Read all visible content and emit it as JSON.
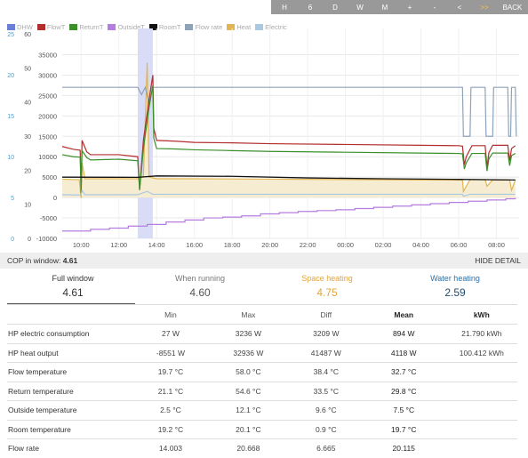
{
  "toolbar": {
    "buttons": [
      {
        "label": "H",
        "accent": false
      },
      {
        "label": "6",
        "accent": false
      },
      {
        "label": "D",
        "accent": false
      },
      {
        "label": "W",
        "accent": false
      },
      {
        "label": "M",
        "accent": false
      },
      {
        "label": "+",
        "accent": false
      },
      {
        "label": "-",
        "accent": false
      },
      {
        "label": "<",
        "accent": false
      },
      {
        "label": ">>",
        "accent": true
      },
      {
        "label": "BACK",
        "accent": false
      }
    ]
  },
  "legend": [
    {
      "label": "DHW",
      "color": "#6a7fd6"
    },
    {
      "label": "FlowT",
      "color": "#b22d2d"
    },
    {
      "label": "ReturnT",
      "color": "#3a8f2a"
    },
    {
      "label": "OutsideT",
      "color": "#b57de0"
    },
    {
      "label": "RoomT",
      "color": "#111111"
    },
    {
      "label": "Flow rate",
      "color": "#8ea3b8"
    },
    {
      "label": "Heat",
      "color": "#e3b552"
    },
    {
      "label": "Electric",
      "color": "#a9c9e3"
    }
  ],
  "chart_data": {
    "type": "line",
    "x_ticks": [
      "10:00",
      "12:00",
      "14:00",
      "16:00",
      "18:00",
      "20:00",
      "22:00",
      "00:00",
      "02:00",
      "04:00",
      "06:00",
      "08:00"
    ],
    "y_axis_left1": {
      "ticks": [
        25,
        20,
        15,
        10,
        5,
        0
      ],
      "color": "#4a9fd6"
    },
    "y_axis_left2": {
      "ticks": [
        60,
        50,
        40,
        30,
        20,
        10,
        0
      ],
      "color": "#555555"
    },
    "y_axis_main": {
      "ticks": [
        35000,
        30000,
        25000,
        20000,
        15000,
        10000,
        5000,
        0,
        -5000,
        -10000
      ],
      "ylim": [
        -10000,
        35000
      ]
    },
    "highlight": {
      "from_hour": 13.0,
      "to_hour": 13.8,
      "color": "#d8dcf6"
    },
    "series": [
      {
        "name": "Heat",
        "kind": "area",
        "color": "#e3b552",
        "fill": "#f5ecd2",
        "points": [
          [
            9,
            4500
          ],
          [
            9.7,
            4400
          ],
          [
            9.9,
            4400
          ],
          [
            10,
            -100
          ],
          [
            10.05,
            8500
          ],
          [
            10.2,
            4600
          ],
          [
            13.0,
            4600
          ],
          [
            13.3,
            5200
          ],
          [
            13.5,
            33000
          ],
          [
            13.6,
            5000
          ],
          [
            14.0,
            4600
          ],
          [
            16,
            4600
          ],
          [
            20,
            4500
          ],
          [
            24,
            4400
          ],
          [
            28,
            4300
          ],
          [
            30.2,
            4300
          ],
          [
            30.25,
            1500
          ],
          [
            30.6,
            4400
          ],
          [
            31.4,
            4400
          ],
          [
            31.5,
            2800
          ],
          [
            31.8,
            4300
          ],
          [
            32.7,
            4300
          ],
          [
            32.8,
            1800
          ],
          [
            33.0,
            4300
          ]
        ]
      },
      {
        "name": "Flow rate",
        "color": "#8ea3b8",
        "points": [
          [
            9,
            20.6
          ],
          [
            13.0,
            20.6
          ],
          [
            13.2,
            19.6
          ],
          [
            13.4,
            20.6
          ],
          [
            13.6,
            18.4
          ],
          [
            13.7,
            20.6
          ],
          [
            30.2,
            20.6
          ],
          [
            30.25,
            14.0
          ],
          [
            30.6,
            14.0
          ],
          [
            30.65,
            20.6
          ],
          [
            31.4,
            20.6
          ],
          [
            31.45,
            14.0
          ],
          [
            31.8,
            14.0
          ],
          [
            31.85,
            20.6
          ],
          [
            32.6,
            20.6
          ],
          [
            32.65,
            14.0
          ],
          [
            32.75,
            14.0
          ],
          [
            32.8,
            20.6
          ],
          [
            33.0,
            20.6
          ],
          [
            33.05,
            14.0
          ]
        ]
      },
      {
        "name": "FlowT",
        "color": "#b22d2d",
        "points": [
          [
            9,
            12500
          ],
          [
            9.6,
            11800
          ],
          [
            9.95,
            11600
          ],
          [
            10.0,
            1200
          ],
          [
            10.05,
            14000
          ],
          [
            10.3,
            11200
          ],
          [
            10.5,
            10500
          ],
          [
            12.0,
            10500
          ],
          [
            13.0,
            10000
          ],
          [
            13.1,
            2000
          ],
          [
            13.3,
            14000
          ],
          [
            13.6,
            24000
          ],
          [
            13.8,
            30000
          ],
          [
            13.85,
            17000
          ],
          [
            14.0,
            14000
          ],
          [
            15,
            13800
          ],
          [
            16,
            13500
          ],
          [
            18,
            13400
          ],
          [
            20,
            13200
          ],
          [
            24,
            13000
          ],
          [
            28,
            12800
          ],
          [
            30,
            12700
          ],
          [
            30.2,
            12600
          ],
          [
            30.3,
            8000
          ],
          [
            30.4,
            10000
          ],
          [
            30.7,
            12700
          ],
          [
            31.4,
            12700
          ],
          [
            31.5,
            7500
          ],
          [
            31.6,
            11000
          ],
          [
            31.8,
            12800
          ],
          [
            32.6,
            12800
          ],
          [
            32.7,
            9000
          ],
          [
            32.8,
            12000
          ],
          [
            33.0,
            12700
          ]
        ]
      },
      {
        "name": "ReturnT",
        "color": "#3a8f2a",
        "points": [
          [
            9,
            10500
          ],
          [
            9.6,
            10000
          ],
          [
            9.95,
            9900
          ],
          [
            10.0,
            1000
          ],
          [
            10.05,
            11500
          ],
          [
            10.3,
            9800
          ],
          [
            10.5,
            9200
          ],
          [
            12.0,
            9400
          ],
          [
            13.0,
            9000
          ],
          [
            13.1,
            1800
          ],
          [
            13.3,
            12000
          ],
          [
            13.6,
            22000
          ],
          [
            13.8,
            27500
          ],
          [
            13.85,
            14500
          ],
          [
            14.0,
            12000
          ],
          [
            15,
            11900
          ],
          [
            16,
            11700
          ],
          [
            18,
            11500
          ],
          [
            20,
            11300
          ],
          [
            24,
            11100
          ],
          [
            28,
            10900
          ],
          [
            30,
            10800
          ],
          [
            30.2,
            10700
          ],
          [
            30.3,
            7000
          ],
          [
            30.4,
            8500
          ],
          [
            30.7,
            10800
          ],
          [
            31.4,
            10800
          ],
          [
            31.5,
            6500
          ],
          [
            31.6,
            9500
          ],
          [
            31.8,
            10900
          ],
          [
            32.6,
            10900
          ],
          [
            32.7,
            7800
          ],
          [
            32.8,
            10300
          ],
          [
            33.0,
            10800
          ]
        ]
      },
      {
        "name": "RoomT",
        "color": "#111111",
        "points": [
          [
            9,
            5000
          ],
          [
            13,
            4950
          ],
          [
            14,
            5300
          ],
          [
            18,
            5200
          ],
          [
            22,
            4800
          ],
          [
            26,
            4600
          ],
          [
            30,
            4450
          ],
          [
            33,
            4300
          ]
        ]
      },
      {
        "name": "Electric",
        "color": "#a9c9e3",
        "points": [
          [
            9,
            700
          ],
          [
            10,
            600
          ],
          [
            10.05,
            1800
          ],
          [
            10.2,
            700
          ],
          [
            13,
            700
          ],
          [
            13.5,
            1500
          ],
          [
            13.8,
            800
          ],
          [
            18,
            800
          ],
          [
            24,
            800
          ],
          [
            30.2,
            800
          ],
          [
            30.25,
            300
          ],
          [
            30.6,
            800
          ],
          [
            33,
            800
          ]
        ]
      },
      {
        "name": "OutsideT",
        "color": "#b57de0",
        "step": true,
        "points": [
          [
            9,
            -8200
          ],
          [
            10.5,
            -7800
          ],
          [
            11.5,
            -7500
          ],
          [
            12.5,
            -7000
          ],
          [
            13.5,
            -6600
          ],
          [
            14.5,
            -6000
          ],
          [
            15.5,
            -5500
          ],
          [
            16.5,
            -5000
          ],
          [
            17.5,
            -4800
          ],
          [
            18.5,
            -4500
          ],
          [
            19.5,
            -4000
          ],
          [
            20.5,
            -3700
          ],
          [
            21.5,
            -3400
          ],
          [
            22.5,
            -3200
          ],
          [
            23.5,
            -3000
          ],
          [
            24.5,
            -2700
          ],
          [
            25.5,
            -2400
          ],
          [
            26.5,
            -2100
          ],
          [
            27.5,
            -1800
          ],
          [
            28.5,
            -1500
          ],
          [
            29.5,
            -1200
          ],
          [
            30.5,
            -900
          ],
          [
            31.5,
            -600
          ],
          [
            32.5,
            -300
          ],
          [
            33,
            -100
          ]
        ]
      }
    ]
  },
  "cop_bar": {
    "label": "COP in window: ",
    "value": "4.61",
    "hide_label": "HIDE DETAIL"
  },
  "summary": [
    {
      "label": "Full window",
      "value": "4.61",
      "label_color": "#333333",
      "value_color": "#333333"
    },
    {
      "label": "When running",
      "value": "4.60",
      "label_color": "#777777",
      "value_color": "#555555"
    },
    {
      "label": "Space heating",
      "value": "4.75",
      "label_color": "#e3a33a",
      "value_color": "#e3a33a"
    },
    {
      "label": "Water heating",
      "value": "2.59",
      "label_color": "#2c6fa8",
      "value_color": "#1f4a6e"
    }
  ],
  "table": {
    "headers": [
      "",
      "Min",
      "Max",
      "Diff",
      "Mean",
      "kWh"
    ],
    "rows": [
      [
        "HP electric consumption",
        "27 W",
        "3236 W",
        "3209 W",
        "894 W",
        "21.790 kWh"
      ],
      [
        "HP heat output",
        "-8551 W",
        "32936 W",
        "41487 W",
        "4118 W",
        "100.412 kWh"
      ],
      [
        "Flow temperature",
        "19.7 °C",
        "58.0 °C",
        "38.4 °C",
        "32.7 °C",
        ""
      ],
      [
        "Return temperature",
        "21.1 °C",
        "54.6 °C",
        "33.5 °C",
        "29.8 °C",
        ""
      ],
      [
        "Outside temperature",
        "2.5 °C",
        "12.1 °C",
        "9.6 °C",
        "7.5 °C",
        ""
      ],
      [
        "Room temperature",
        "19.2 °C",
        "20.1 °C",
        "0.9 °C",
        "19.7 °C",
        ""
      ],
      [
        "Flow rate",
        "14.003",
        "20.668",
        "6.665",
        "20.115",
        ""
      ]
    ]
  }
}
